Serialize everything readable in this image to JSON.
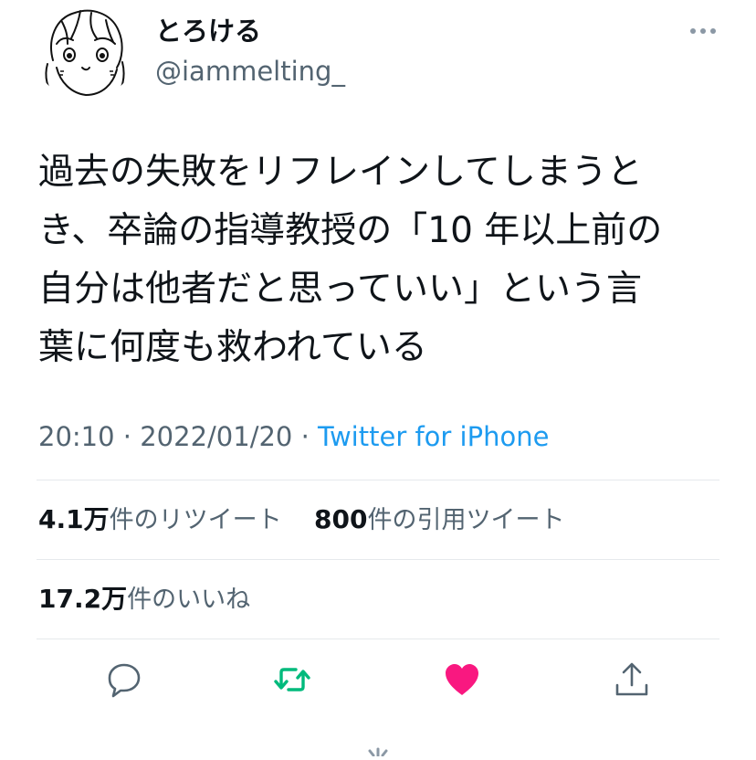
{
  "tweet": {
    "display_name": "とろける",
    "handle": "@iammelting_",
    "text_lines": [
      "過去の失敗をリフレインしてしまうと",
      "き、卒論の指導教授の「10 年以上前の",
      "自分は他者だと思っていい」という言",
      "葉に何度も救われている"
    ],
    "time": "20:10",
    "date": "2022/01/20",
    "separator": "·",
    "source": "Twitter for iPhone"
  },
  "stats": {
    "retweets_value": "4.1",
    "retweets_unit": "万",
    "retweets_label": "件のリツイート",
    "quotes_value": "800",
    "quotes_label": "件の引用ツイート",
    "likes_value": "17.2",
    "likes_unit": "万",
    "likes_label": "件のいいね"
  },
  "colors": {
    "text": "#0f1419",
    "secondary": "#536471",
    "link": "#1d9bf0",
    "retweet": "#00ba7c",
    "like": "#f91880"
  },
  "icons": [
    "more-icon",
    "reply-icon",
    "retweet-icon",
    "like-icon",
    "share-icon",
    "loading-icon"
  ]
}
